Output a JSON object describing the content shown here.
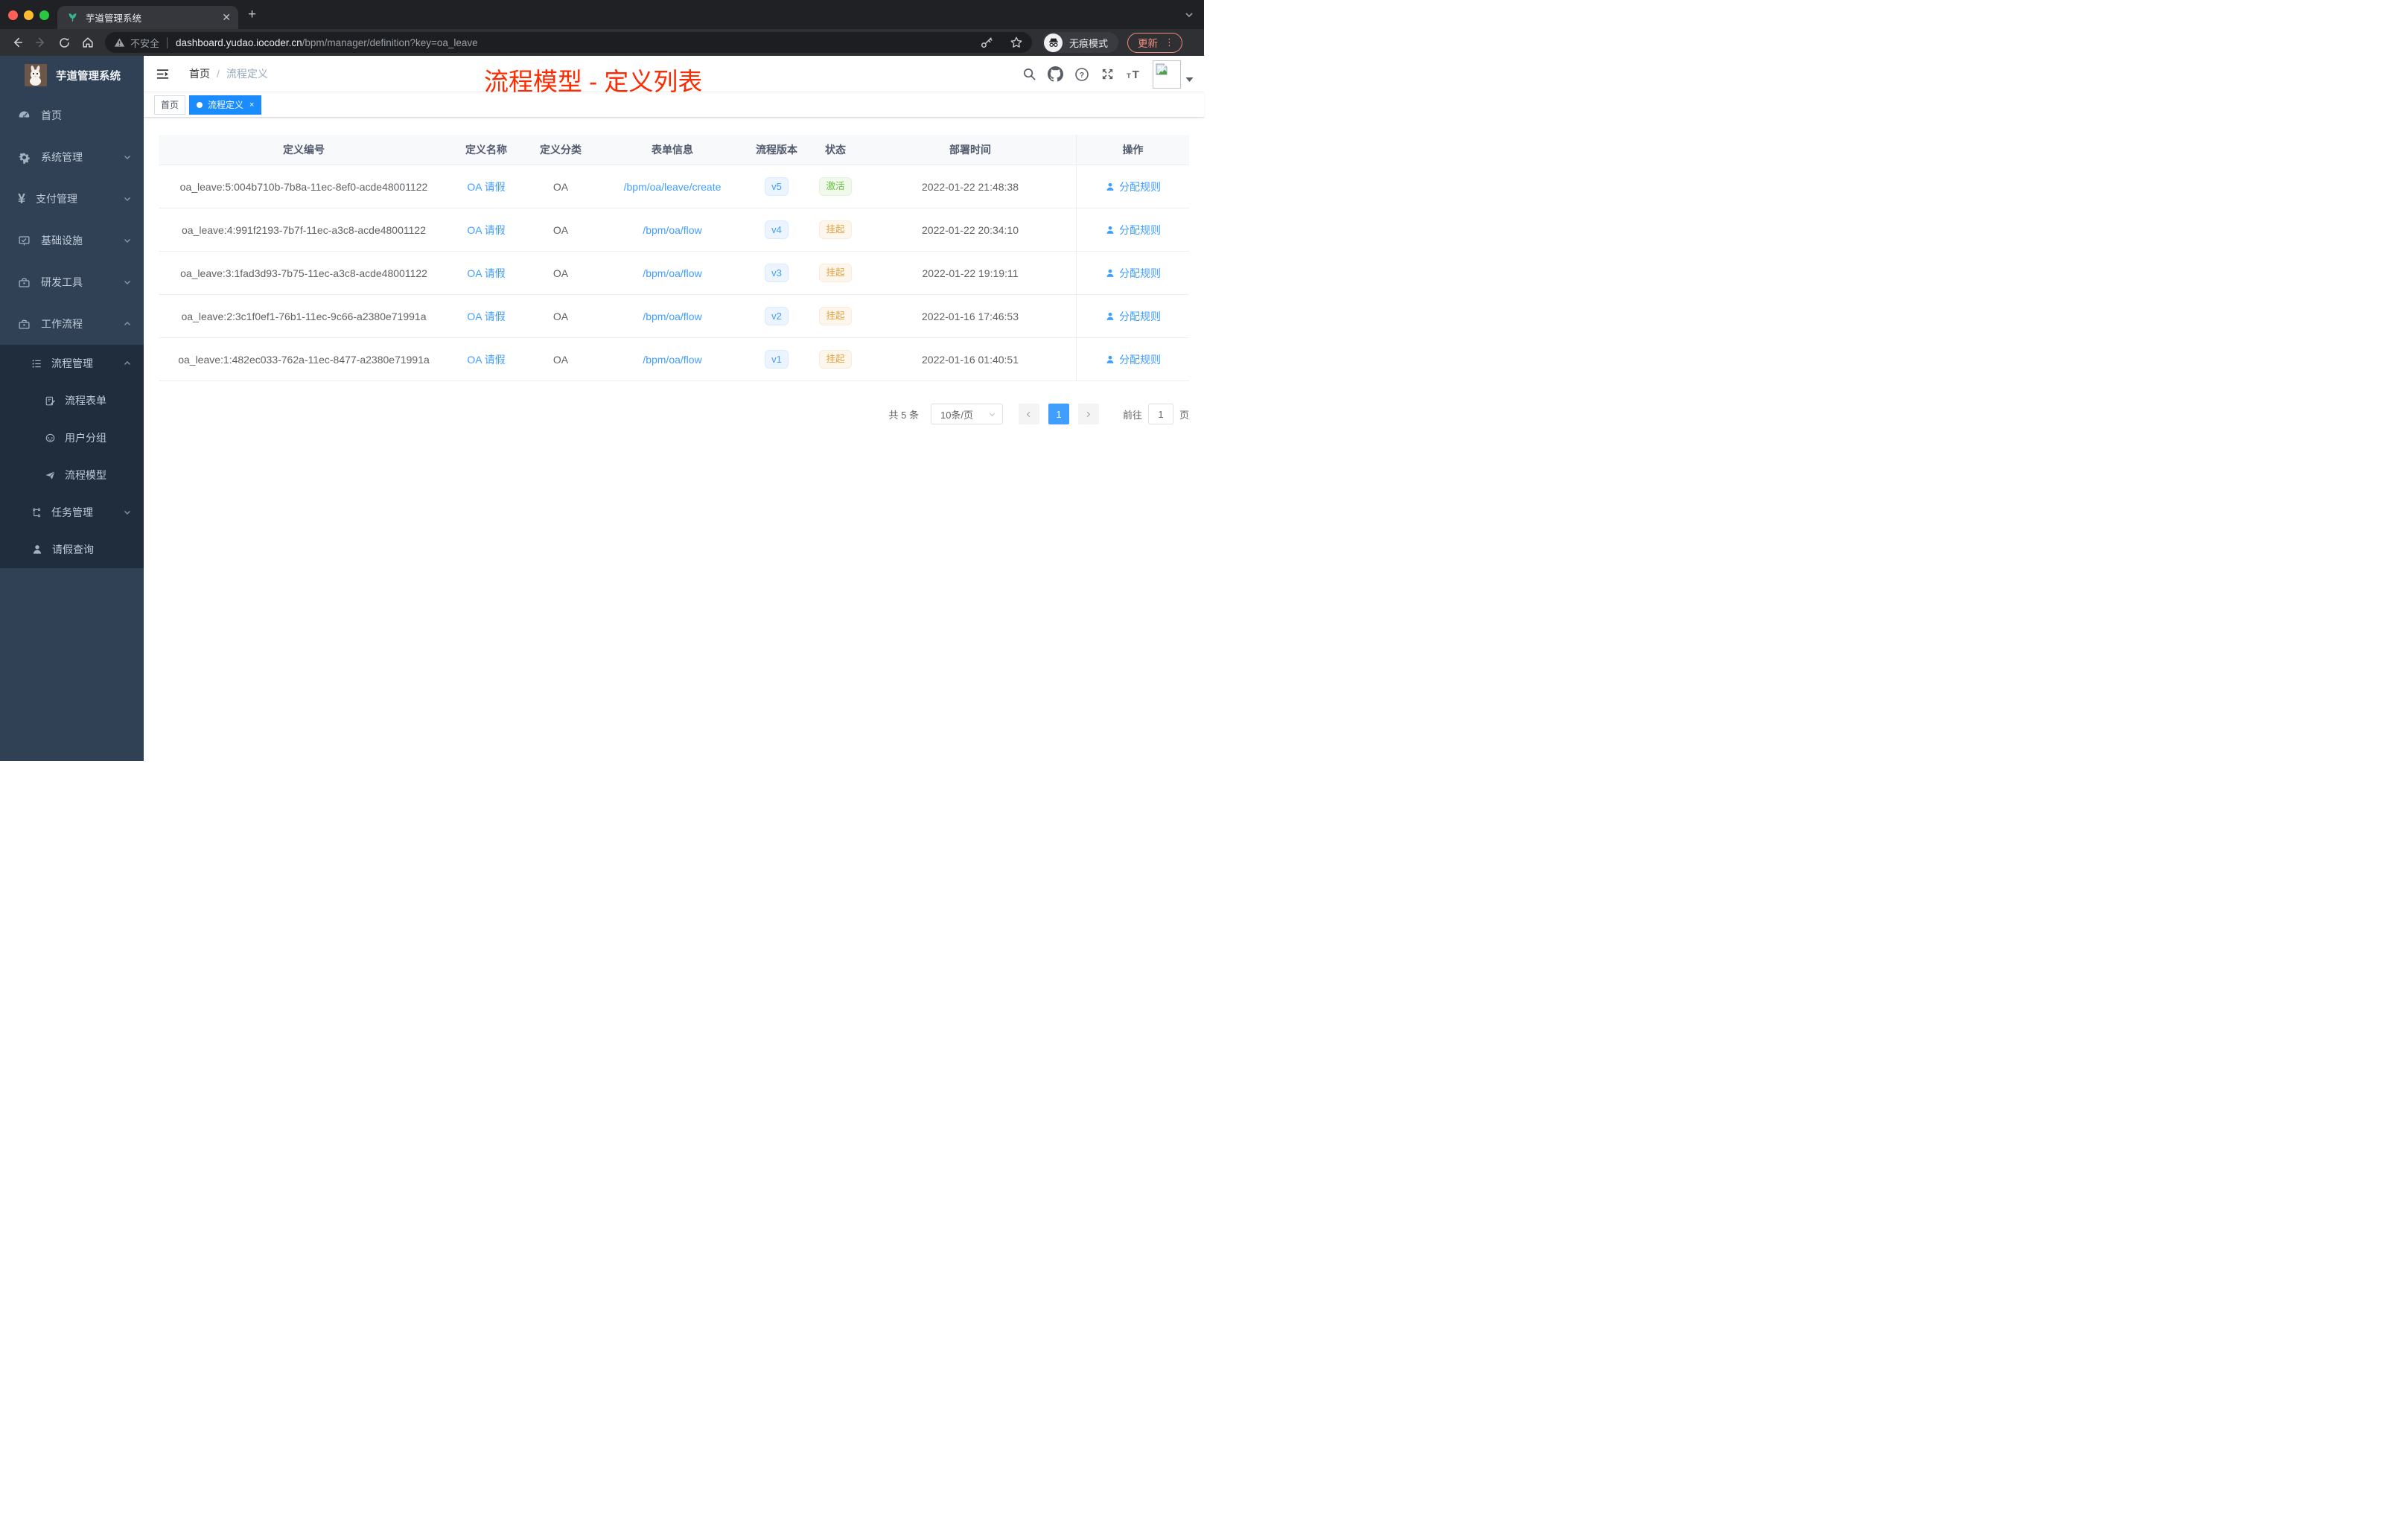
{
  "browser": {
    "tab_title": "芋道管理系统",
    "new_tab": "+",
    "close_tab": "✕",
    "security_label": "不安全",
    "url_host": "dashboard.yudao.iocoder.cn",
    "url_path": "/bpm/manager/definition?key=oa_leave",
    "incognito_label": "无痕模式",
    "update_label": "更新",
    "menu_dots": "⋮"
  },
  "sidebar": {
    "app_title": "芋道管理系统",
    "items": [
      {
        "label": "首页",
        "icon": "dashboard-icon",
        "chevron": null
      },
      {
        "label": "系统管理",
        "icon": "gear-icon",
        "chevron": "down"
      },
      {
        "label": "支付管理",
        "icon": "yen-icon",
        "chevron": "down"
      },
      {
        "label": "基础设施",
        "icon": "infrastructure-icon",
        "chevron": "down"
      },
      {
        "label": "研发工具",
        "icon": "toolbox-icon",
        "chevron": "down"
      },
      {
        "label": "工作流程",
        "icon": "toolbox-icon",
        "chevron": "up"
      }
    ],
    "submenu": [
      {
        "label": "流程管理",
        "icon": "tree-list-icon",
        "chevron": "up",
        "level": 2
      },
      {
        "label": "流程表单",
        "icon": "form-icon",
        "chevron": null,
        "level": 3
      },
      {
        "label": "用户分组",
        "icon": "group-icon",
        "chevron": null,
        "level": 3
      },
      {
        "label": "流程模型",
        "icon": "paper-plane-icon",
        "chevron": null,
        "level": 3
      },
      {
        "label": "任务管理",
        "icon": "tree-icon",
        "chevron": "down",
        "level": 2
      },
      {
        "label": "请假查询",
        "icon": "user-icon",
        "chevron": null,
        "level": 2
      }
    ]
  },
  "header": {
    "breadcrumb_home": "首页",
    "breadcrumb_sep": "/",
    "breadcrumb_current": "流程定义"
  },
  "annotation": {
    "title": "流程模型 - 定义列表",
    "color": "#fd2b01"
  },
  "tags": {
    "home": "首页",
    "active": "流程定义",
    "active_close": "×",
    "active_color": "#1a8cff"
  },
  "table": {
    "columns": [
      "定义编号",
      "定义名称",
      "定义分类",
      "表单信息",
      "流程版本",
      "状态",
      "部署时间",
      "操作"
    ],
    "accent_color": "#409eff",
    "status_colors": {
      "success": "#67c23a",
      "warning": "#e6a23c"
    },
    "rows": [
      {
        "id": "oa_leave:5:004b710b-7b8a-11ec-8ef0-acde48001122",
        "name": "OA 请假",
        "category": "OA",
        "form": "/bpm/oa/leave/create",
        "version": "v5",
        "status": "激活",
        "status_type": "success",
        "deploy_time": "2022-01-22 21:48:38",
        "action": "分配规则"
      },
      {
        "id": "oa_leave:4:991f2193-7b7f-11ec-a3c8-acde48001122",
        "name": "OA 请假",
        "category": "OA",
        "form": "/bpm/oa/flow",
        "version": "v4",
        "status": "挂起",
        "status_type": "warning",
        "deploy_time": "2022-01-22 20:34:10",
        "action": "分配规则"
      },
      {
        "id": "oa_leave:3:1fad3d93-7b75-11ec-a3c8-acde48001122",
        "name": "OA 请假",
        "category": "OA",
        "form": "/bpm/oa/flow",
        "version": "v3",
        "status": "挂起",
        "status_type": "warning",
        "deploy_time": "2022-01-22 19:19:11",
        "action": "分配规则"
      },
      {
        "id": "oa_leave:2:3c1f0ef1-76b1-11ec-9c66-a2380e71991a",
        "name": "OA 请假",
        "category": "OA",
        "form": "/bpm/oa/flow",
        "version": "v2",
        "status": "挂起",
        "status_type": "warning",
        "deploy_time": "2022-01-16 17:46:53",
        "action": "分配规则"
      },
      {
        "id": "oa_leave:1:482ec033-762a-11ec-8477-a2380e71991a",
        "name": "OA 请假",
        "category": "OA",
        "form": "/bpm/oa/flow",
        "version": "v1",
        "status": "挂起",
        "status_type": "warning",
        "deploy_time": "2022-01-16 01:40:51",
        "action": "分配规则"
      }
    ]
  },
  "pagination": {
    "total": "共 5 条",
    "page_size": "10条/页",
    "current_page": "1",
    "goto_label": "前往",
    "goto_value": "1",
    "page_unit": "页"
  }
}
